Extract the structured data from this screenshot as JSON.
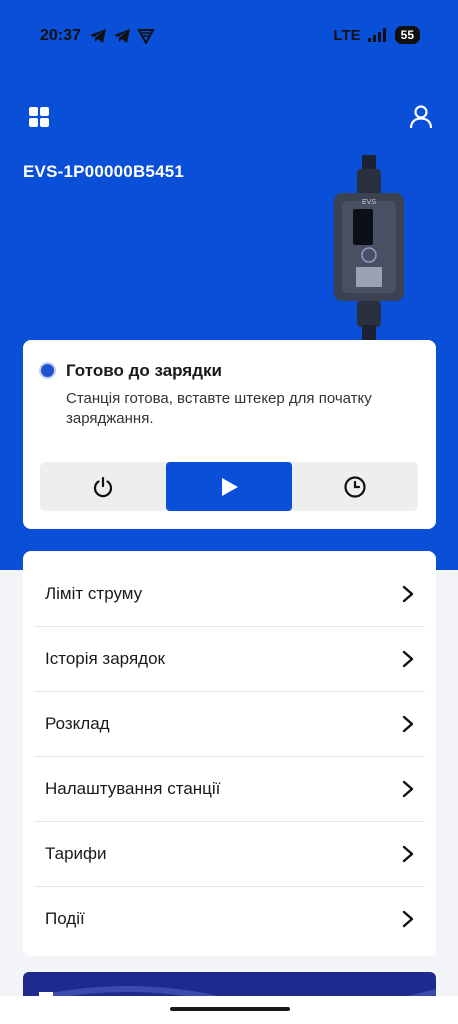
{
  "status_bar": {
    "time": "20:37",
    "network": "LTE",
    "battery": "55",
    "icons": [
      "telegram-icon",
      "telegram-icon",
      "vpn-icon",
      "signal-icon"
    ]
  },
  "header": {
    "device_id": "EVS-1P00000B5451",
    "left_icon": "grid-icon",
    "right_icon": "user-icon"
  },
  "device_image": {
    "label": "EVS"
  },
  "status": {
    "title": "Готово до зарядки",
    "description": "Станція готова, вставте штекер для початку заряджання.",
    "dot_color": "#1e52cf"
  },
  "controls": {
    "icons": [
      "power-icon",
      "play-icon",
      "clock-icon"
    ],
    "active": "play"
  },
  "menu": {
    "items": [
      {
        "label": "Ліміт струму"
      },
      {
        "label": "Історія зарядок"
      },
      {
        "label": "Розклад"
      },
      {
        "label": "Налаштування станції"
      },
      {
        "label": "Тарифи"
      },
      {
        "label": "Події"
      }
    ]
  },
  "colors": {
    "accent": "#0a4fd8",
    "background": "#f3f5f9",
    "card": "#ffffff"
  }
}
